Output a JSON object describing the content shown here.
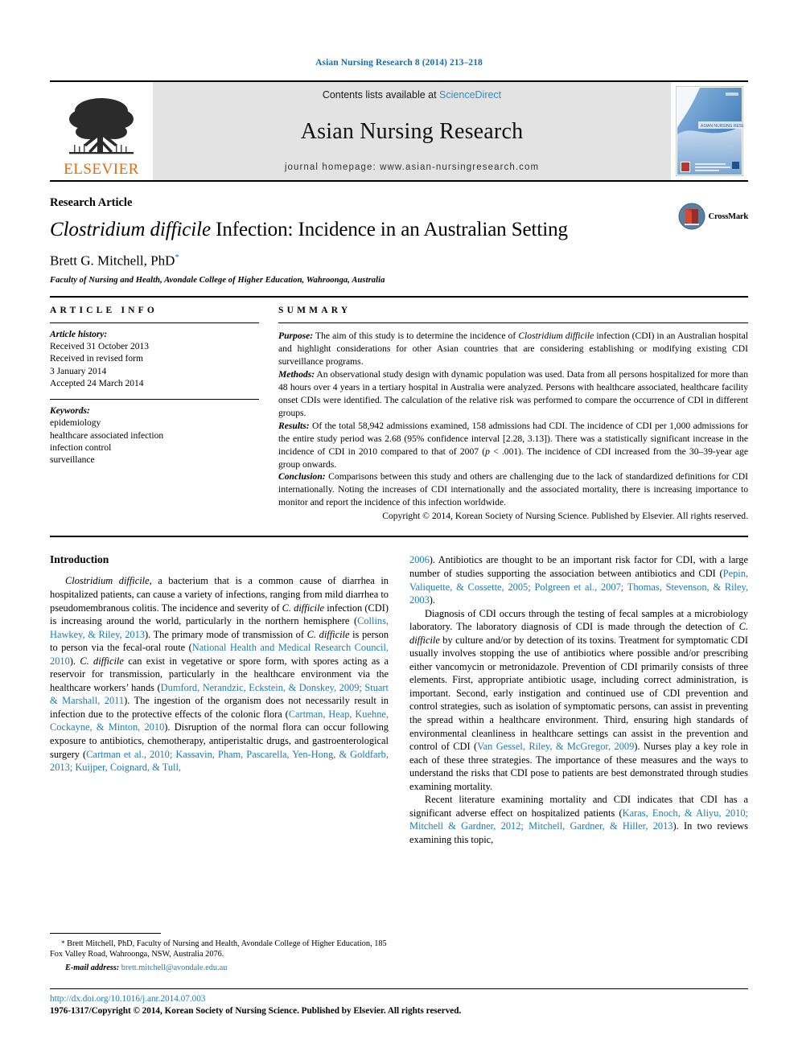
{
  "running_head": "Asian Nursing Research 8 (2014) 213–218",
  "header": {
    "publisher_name": "ELSEVIER",
    "contents_prefix": "Contents lists available at ",
    "sciencedirect": "ScienceDirect",
    "journal_title": "Asian Nursing Research",
    "homepage": "journal homepage: www.asian-nursingresearch.com",
    "cover_caption": "ASIAN NURSING RESEARCH"
  },
  "title_block": {
    "article_type": "Research Article",
    "title_italic": "Clostridium difficile",
    "title_rest": " Infection: Incidence in an Australian Setting",
    "author": "Brett G. Mitchell, PhD",
    "author_mark": "*",
    "affiliation": "Faculty of Nursing and Health, Avondale College of Higher Education, Wahroonga, Australia",
    "crossmark_label": "CrossMark"
  },
  "article_info": {
    "heading": "ARTICLE INFO",
    "history_label": "Article history:",
    "history": [
      "Received 31 October 2013",
      "Received in revised form",
      "3 January 2014",
      "Accepted 24 March 2014"
    ],
    "keywords_label": "Keywords:",
    "keywords": [
      "epidemiology",
      "healthcare associated infection",
      "infection control",
      "surveillance"
    ]
  },
  "summary": {
    "heading": "SUMMARY",
    "purpose_label": "Purpose:",
    "purpose_text_a": " The aim of this study is to determine the incidence of ",
    "purpose_italic": "Clostridium difficile",
    "purpose_text_b": " infection (CDI) in an Australian hospital and highlight considerations for other Asian countries that are considering establishing or modifying existing CDI surveillance programs.",
    "methods_label": "Methods:",
    "methods_text": " An observational study design with dynamic population was used. Data from all persons hospitalized for more than 48 hours over 4 years in a tertiary hospital in Australia were analyzed. Persons with healthcare associated, healthcare facility onset CDIs were identified. The calculation of the relative risk was performed to compare the occurrence of CDI in different groups.",
    "results_label": "Results:",
    "results_text_a": " Of the total 58,942 admissions examined, 158 admissions had CDI. The incidence of CDI per 1,000 admissions for the entire study period was 2.68 (95% confidence interval [2.28, 3.13]). There was a statistically significant increase in the incidence of CDI in 2010 compared to that of 2007 (",
    "results_p_italic": "p",
    "results_text_b": " < .001). The incidence of CDI increased from the 30–39-year age group onwards.",
    "conclusion_label": "Conclusion:",
    "conclusion_text": " Comparisons between this study and others are challenging due to the lack of standardized definitions for CDI internationally. Noting the increases of CDI internationally and the associated mortality, there is increasing importance to monitor and report the incidence of this infection worldwide.",
    "copyright": "Copyright © 2014, Korean Society of Nursing Science. Published by Elsevier. All rights reserved."
  },
  "body": {
    "intro_heading": "Introduction",
    "left_para_1_a": "Clostridium difficile",
    "left_para_1_b": ", a bacterium that is a common cause of diarrhea in hospitalized patients, can cause a variety of infections, ranging from mild diarrhea to pseudomembranous colitis. The incidence and severity of ",
    "left_para_1_c": "C. difficile",
    "left_para_1_d": " infection (CDI) is increasing around the world, particularly in the northern hemisphere (",
    "left_ref_1": "Collins, Hawkey, & Riley, 2013",
    "left_para_1_e": "). The primary mode of transmission of ",
    "left_para_1_f": "C. difficile",
    "left_para_1_g": " is person to person via the fecal-oral route (",
    "left_ref_2": "National Health and Medical Research Council, 2010",
    "left_para_1_h": "). ",
    "left_para_1_i": "C. difficile",
    "left_para_1_j": " can exist in vegetative or spore form, with spores acting as a reservoir for transmission, particularly in the healthcare environment via the healthcare workers’ hands (",
    "left_ref_3": "Dumford, Nerandzic, Eckstein, & Donskey, 2009; Stuart & Marshall, 2011",
    "left_para_1_k": "). The ingestion of the organism does not necessarily result in infection due to the protective effects of the colonic flora (",
    "left_ref_4": "Cartman, Heap, Kuehne, Cockayne, & Minton, 2010",
    "left_para_1_l": "). Disruption of the normal flora can occur following exposure to antibiotics, chemotherapy, antiperistaltic drugs, and gastroenterological surgery (",
    "left_ref_5": "Cartman et al., 2010; Kassavin, Pham, Pascarella, Yen-Hong, & Goldfarb, 2013; Kuijper, Coignard, & Tull,",
    "right_ref_0": "2006",
    "right_para_1_a": "). Antibiotics are thought to be an important risk factor for CDI, with a large number of studies supporting the association between antibiotics and CDI (",
    "right_ref_1": "Pepin, Valiquette, & Cossette, 2005; Polgreen et al., 2007; Thomas, Stevenson, & Riley, 2003",
    "right_para_1_b": ").",
    "right_para_2_a": "Diagnosis of CDI occurs through the testing of fecal samples at a microbiology laboratory. The laboratory diagnosis of CDI is made through the detection of ",
    "right_para_2_italic": "C. difficile",
    "right_para_2_b": " by culture and/or by detection of its toxins. Treatment for symptomatic CDI usually involves stopping the use of antibiotics where possible and/or prescribing either vancomycin or metronidazole. Prevention of CDI primarily consists of three elements. First, appropriate antibiotic usage, including correct administration, is important. Second, early instigation and continued use of CDI prevention and control strategies, such as isolation of symptomatic persons, can assist in preventing the spread within a healthcare environment. Third, ensuring high standards of environmental cleanliness in healthcare settings can assist in the prevention and control of CDI (",
    "right_ref_2": "Van Gessel, Riley, & McGregor, 2009",
    "right_para_2_c": "). Nurses play a key role in each of these three strategies. The importance of these measures and the ways to understand the risks that CDI pose to patients are best demonstrated through studies examining mortality.",
    "right_para_3_a": "Recent literature examining mortality and CDI indicates that CDI has a significant adverse effect on hospitalized patients (",
    "right_ref_3": "Karas, Enoch, & Aliyu, 2010; Mitchell & Gardner, 2012; Mitchell, Gardner, & Hiller, 2013",
    "right_para_3_b": "). In two reviews examining this topic,"
  },
  "footnote": {
    "mark": "*",
    "text": " Brett Mitchell, PhD, Faculty of Nursing and Health, Avondale College of Higher Education, 185 Fox Valley Road, Wahroonga, NSW, Australia 2076.",
    "email_label": "E-mail address:",
    "email": "brett.mitchell@avondale.edu.au"
  },
  "footer": {
    "doi": "http://dx.doi.org/10.1016/j.anr.2014.07.003",
    "issn_line": "1976-1317/Copyright © 2014, Korean Society of Nursing Science. Published by Elsevier. All rights reserved."
  },
  "colors": {
    "link": "#1a7bb0",
    "sciencedirect": "#2b8fce",
    "elsevier_orange": "#E36C0A",
    "band_gray": "#e3e3e3"
  }
}
